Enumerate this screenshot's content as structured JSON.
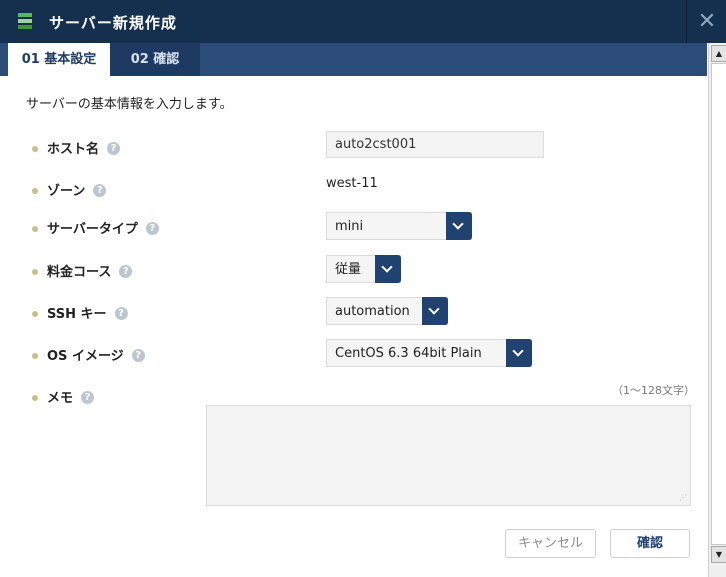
{
  "dialog": {
    "title": "サーバー新規作成",
    "close_glyph": "✕"
  },
  "tabs": [
    {
      "label": "01 基本設定",
      "active": true
    },
    {
      "label": "02 確認",
      "active": false
    }
  ],
  "intro": "サーバーの基本情報を入力します。",
  "form": {
    "host": {
      "label": "ホスト名",
      "value": "auto2cst001"
    },
    "zone": {
      "label": "ゾーン",
      "value": "west-11"
    },
    "server_type": {
      "label": "サーバータイプ",
      "value": "mini"
    },
    "plan": {
      "label": "料金コース",
      "value": "従量"
    },
    "ssh_key": {
      "label": "SSH キー",
      "value": "automation"
    },
    "os_image": {
      "label": "OS イメージ",
      "value": "CentOS 6.3 64bit Plain"
    },
    "memo": {
      "label": "メモ",
      "hint": "（1～128文字）",
      "value": ""
    }
  },
  "help_glyph": "?",
  "buttons": {
    "cancel": "キャンセル",
    "confirm": "確認"
  },
  "colors": {
    "titlebar": "#15304f",
    "tabbar": "#2b4b78",
    "accent": "#1f4271",
    "bullet": "#c8bf86"
  }
}
